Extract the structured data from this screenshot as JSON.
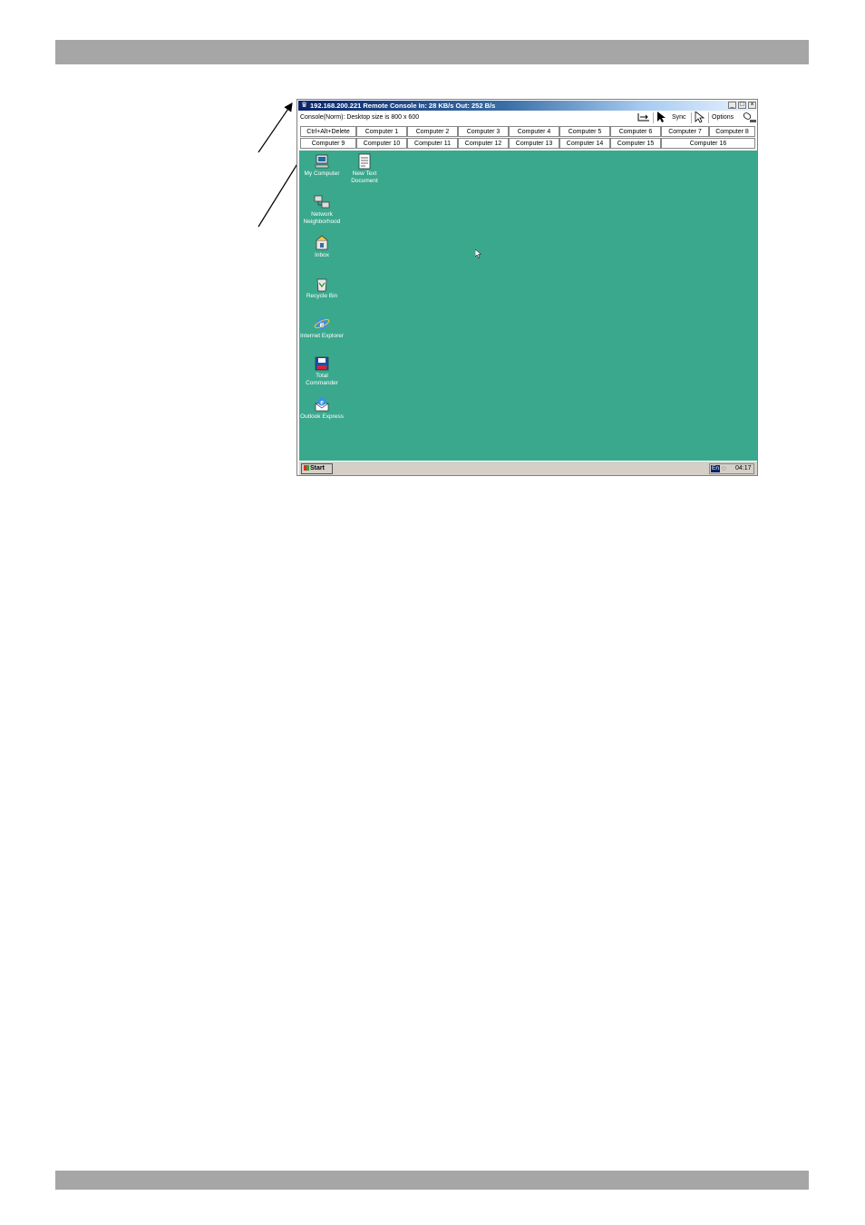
{
  "window": {
    "title": "192.168.200.221 Remote Console In: 28 KB/s Out: 252 B/s",
    "controls": {
      "minimize": "_",
      "maximize": "□",
      "close": "×"
    }
  },
  "status_line": "Console(Norm): Desktop size is 800 x 600",
  "toolbar": {
    "scale_icon": "scale-icon",
    "cursor_icon": "cursor-icon",
    "sync_label": "Sync",
    "pointer_icon": "pointer-icon",
    "options_label": "Options",
    "mouse_icon": "mouse-icon"
  },
  "console_buttons": {
    "row1": [
      "Ctrl+Alt+Delete",
      "Computer 1",
      "Computer 2",
      "Computer 3",
      "Computer 4",
      "Computer 5",
      "Computer 6",
      "Computer 7",
      "Computer 8"
    ],
    "row2": [
      "Computer 9",
      "Computer 10",
      "Computer 11",
      "Computer 12",
      "Computer 13",
      "Computer 14",
      "Computer 15",
      "Computer 16"
    ]
  },
  "desktop": {
    "background": "#3aa88d",
    "icons": [
      {
        "label": "My Computer",
        "icon": "computer-icon"
      },
      {
        "label": "New Text Document",
        "icon": "text-document-icon"
      },
      {
        "label": "Network Neighborhood",
        "icon": "network-icon"
      },
      {
        "label": "Inbox",
        "icon": "inbox-icon"
      },
      {
        "label": "Recycle Bin",
        "icon": "recycle-bin-icon"
      },
      {
        "label": "Internet Explorer",
        "icon": "internet-explorer-icon"
      },
      {
        "label": "Total Commander",
        "icon": "total-commander-icon"
      },
      {
        "label": "Outlook Express",
        "icon": "outlook-express-icon"
      }
    ]
  },
  "taskbar": {
    "start_label": "Start",
    "language": "En",
    "clock": "04:17"
  }
}
